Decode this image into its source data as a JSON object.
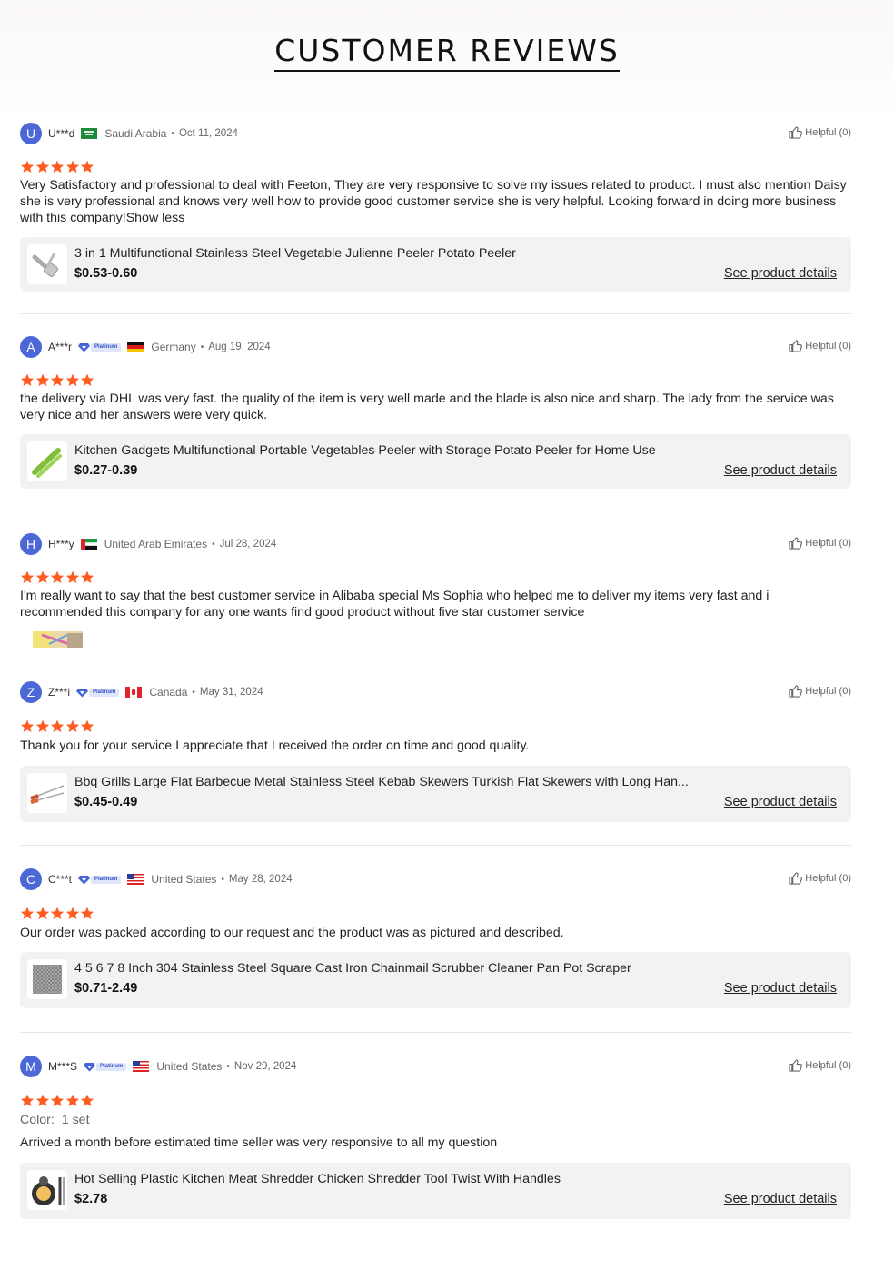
{
  "page_title": "CUSTOMER REVIEWS",
  "colors": {
    "star": "#ff5a1f",
    "avatar": "#4c67d6",
    "card_bg": "#f2f2f2",
    "badge_blue": "#3553c8"
  },
  "reviews": [
    {
      "initial": "U",
      "user": "U***d",
      "badge": "",
      "flag": "saudi-arabia-flag",
      "country": "Saudi Arabia",
      "date": "Oct 11, 2024",
      "helpful": "Helpful (0)",
      "rating": 5,
      "text": "Very Satisfactory and professional to deal with Feeton, They are very responsive to solve my issues related to product. I must also mention Daisy she is very professional and knows very well how to provide good customer service she is very helpful. Looking forward in doing more business with this company!",
      "show_less": "Show less",
      "product": {
        "name": "3 in 1 Multifunctional Stainless Steel Vegetable Julienne Peeler Potato Peeler",
        "price": "$0.53-0.60",
        "link": "See product details"
      }
    },
    {
      "initial": "A",
      "user": "A***r",
      "badge": "Platinum",
      "flag": "germany-flag",
      "country": "Germany",
      "date": "Aug 19, 2024",
      "helpful": "Helpful (0)",
      "rating": 5,
      "text": "the delivery via DHL was very fast. the quality of the item is very well made and the blade is also nice and sharp. The lady from the service was very nice and her answers were very quick.",
      "product": {
        "name": "Kitchen Gadgets Multifunctional Portable Vegetables Peeler with Storage Potato Peeler for Home Use",
        "price": "$0.27-0.39",
        "link": "See product details"
      }
    },
    {
      "initial": "H",
      "user": "H***y",
      "badge": "",
      "flag": "uae-flag",
      "country": "United Arab Emirates",
      "date": "Jul 28, 2024",
      "helpful": "Helpful (0)",
      "rating": 5,
      "text": "I'm really want to say that the best customer service in Alibaba special Ms Sophia who helped me to deliver my items very fast and i recommended this company for any one wants find good product without five star customer service"
    },
    {
      "initial": "Z",
      "user": "Z***i",
      "badge": "Platinum",
      "flag": "canada-flag",
      "country": "Canada",
      "date": "May 31,  2024",
      "helpful": "Helpful (0)",
      "rating": 5,
      "text": "Thank you for your service I appreciate that I received the order on time and good quality.",
      "product": {
        "name": "Bbq Grills Large Flat Barbecue Metal Stainless Steel Kebab Skewers Turkish Flat Skewers with Long Han...",
        "price": "$0.45-0.49",
        "link": "See product details"
      }
    },
    {
      "initial": "C",
      "user": "C***t",
      "badge": "Platinum",
      "flag": "us-flag",
      "country": "United States",
      "date": "May 28, 2024",
      "helpful": "Helpful (0)",
      "rating": 5,
      "text": "Our order was packed according to our request and the product was as pictured and described.",
      "product": {
        "name": "4 5 6 7 8 Inch 304 Stainless Steel Square Cast Iron Chainmail Scrubber Cleaner Pan Pot Scraper",
        "price": "$0.71-2.49",
        "link": "See product details"
      }
    },
    {
      "initial": "M",
      "user": "M***S",
      "badge": "Platinum",
      "flag": "us-flag",
      "country": "United States",
      "date": "Nov 29, 2024",
      "helpful": "Helpful (0)",
      "rating": 5,
      "color_label": "Color:",
      "color_value": "1 set",
      "text": "Arrived a month before estimated time seller was very responsive to all my question",
      "product": {
        "name": "Hot Selling Plastic Kitchen Meat Shredder Chicken Shredder Tool Twist With Handles",
        "price": "$2.78",
        "link": "See product details"
      }
    }
  ]
}
